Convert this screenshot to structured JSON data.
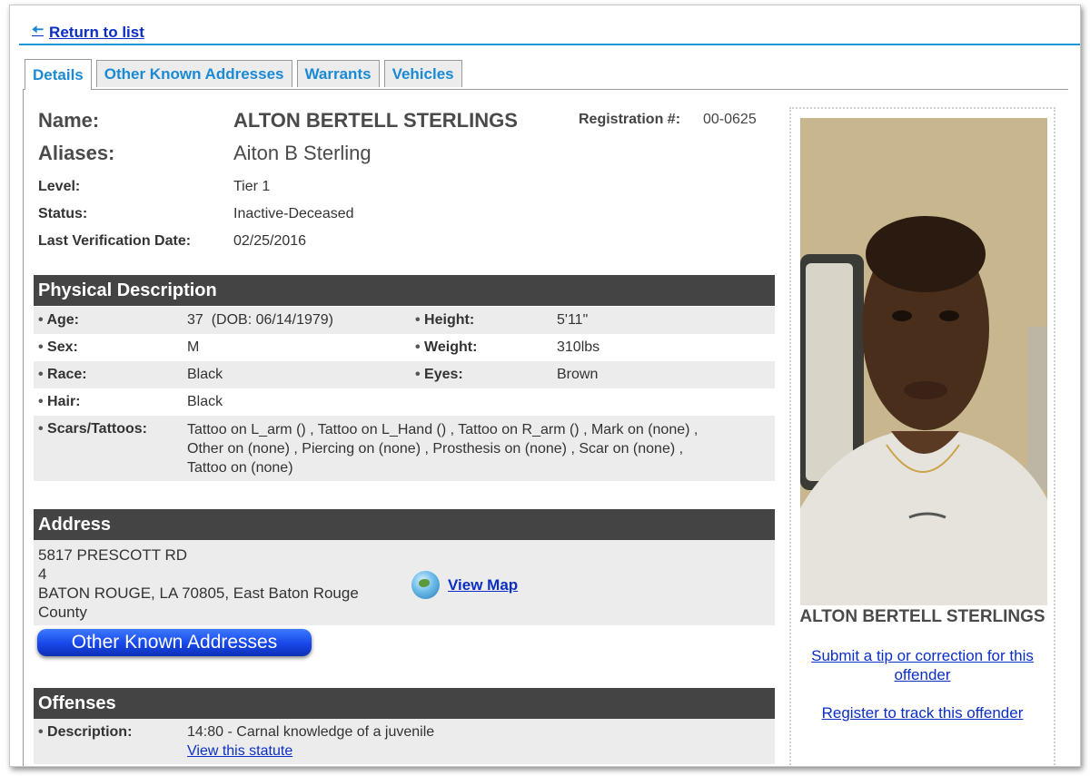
{
  "nav": {
    "return_label": "Return to list"
  },
  "tabs": [
    "Details",
    "Other Known Addresses",
    "Warrants",
    "Vehicles"
  ],
  "header": {
    "name_label": "Name:",
    "name": "ALTON BERTELL STERLINGS",
    "registration_label": "Registration #:",
    "registration": "00-0625",
    "aliases_label": "Aliases:",
    "aliases": "Aiton B Sterling",
    "level_label": "Level:",
    "level": "Tier 1",
    "status_label": "Status:",
    "status": "Inactive-Deceased",
    "verification_label": "Last Verification Date:",
    "verification_date": "02/25/2016"
  },
  "physical": {
    "title": "Physical Description",
    "age_label": "Age:",
    "age": "37  (DOB: 06/14/1979)",
    "height_label": "Height:",
    "height": "5'11\"",
    "sex_label": "Sex:",
    "sex": "M",
    "weight_label": "Weight:",
    "weight": "310lbs",
    "race_label": "Race:",
    "race": "Black",
    "eyes_label": "Eyes:",
    "eyes": "Brown",
    "hair_label": "Hair:",
    "hair": "Black",
    "scars_label": "Scars/Tattoos:",
    "scars_line1": "Tattoo on L_arm () , Tattoo on L_Hand () , Tattoo on R_arm () , Mark on (none) ,",
    "scars_line2": "Other on (none) , Piercing on (none) , Prosthesis on (none) , Scar on (none) ,",
    "scars_line3": "Tattoo on (none)"
  },
  "address": {
    "title": "Address",
    "line1": "5817 PRESCOTT RD",
    "line2": "4",
    "line3": "BATON ROUGE, LA 70805, East Baton Rouge",
    "line4": "County",
    "map_label": "View Map",
    "other_button": "Other Known Addresses"
  },
  "offenses": {
    "title": "Offenses",
    "desc_label": "Description:",
    "desc": "14:80 - Carnal knowledge of a juvenile",
    "statute_link": "View this statute"
  },
  "sidebar": {
    "photo_name": "ALTON BERTELL STERLINGS",
    "tip_line1": "Submit a tip or correction for this",
    "tip_line2": "offender",
    "register_link": "Register to track this offender"
  },
  "colors": {
    "section_header": "#444444",
    "tab_text": "#1a8ad4",
    "link": "#0b2fc4",
    "rule": "#1b97d8"
  }
}
